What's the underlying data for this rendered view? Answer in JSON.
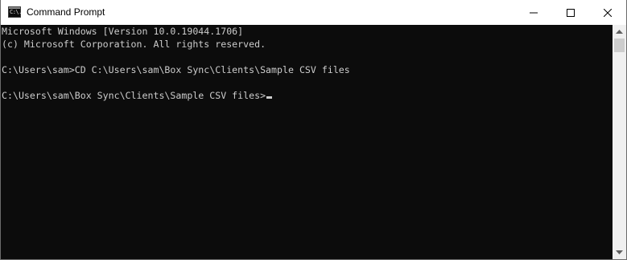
{
  "window": {
    "title": "Command Prompt",
    "icon": "cmd-icon",
    "icon_glyph": "C:\\."
  },
  "caption_buttons": {
    "minimize_icon": "minimize-icon",
    "maximize_icon": "maximize-icon",
    "close_icon": "close-icon"
  },
  "console": {
    "background": "#0c0c0c",
    "text_color": "#cccccc",
    "lines": [
      "Microsoft Windows [Version 10.0.19044.1706]",
      "(c) Microsoft Corporation. All rights reserved.",
      "",
      "C:\\Users\\sam>CD C:\\Users\\sam\\Box Sync\\Clients\\Sample CSV files",
      "",
      "C:\\Users\\sam\\Box Sync\\Clients\\Sample CSV files>"
    ]
  },
  "scrollbar": {
    "up_icon": "scroll-up-arrow-icon",
    "down_icon": "scroll-down-arrow-icon"
  }
}
